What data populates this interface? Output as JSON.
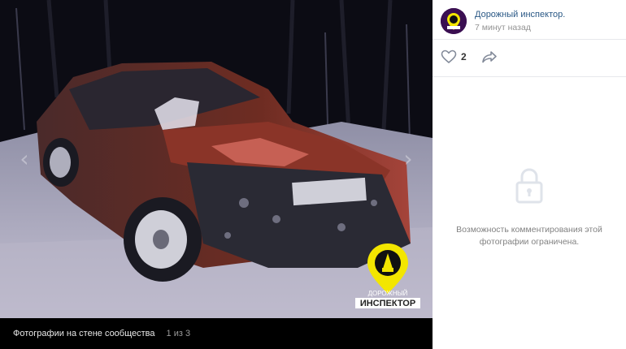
{
  "viewer": {
    "nav_prev_icon": "chevron-left-icon",
    "nav_next_icon": "chevron-right-icon",
    "watermark": {
      "line1": "ДОРОЖНЫЙ",
      "line2": "ИНСПЕКТОР",
      "accent_color": "#f3e600"
    },
    "album_label": "Фотографии на стене сообщества",
    "counter": "1 из 3"
  },
  "sidebar": {
    "author_name": "Дорожный инспектор.",
    "post_time": "7 минут назад",
    "likes": "2",
    "like_icon": "heart-icon",
    "share_icon": "share-icon",
    "comments_restricted": "Возможность комментирования этой фотографии ограничена.",
    "lock_icon": "lock-icon",
    "link_color": "#2a5885"
  }
}
